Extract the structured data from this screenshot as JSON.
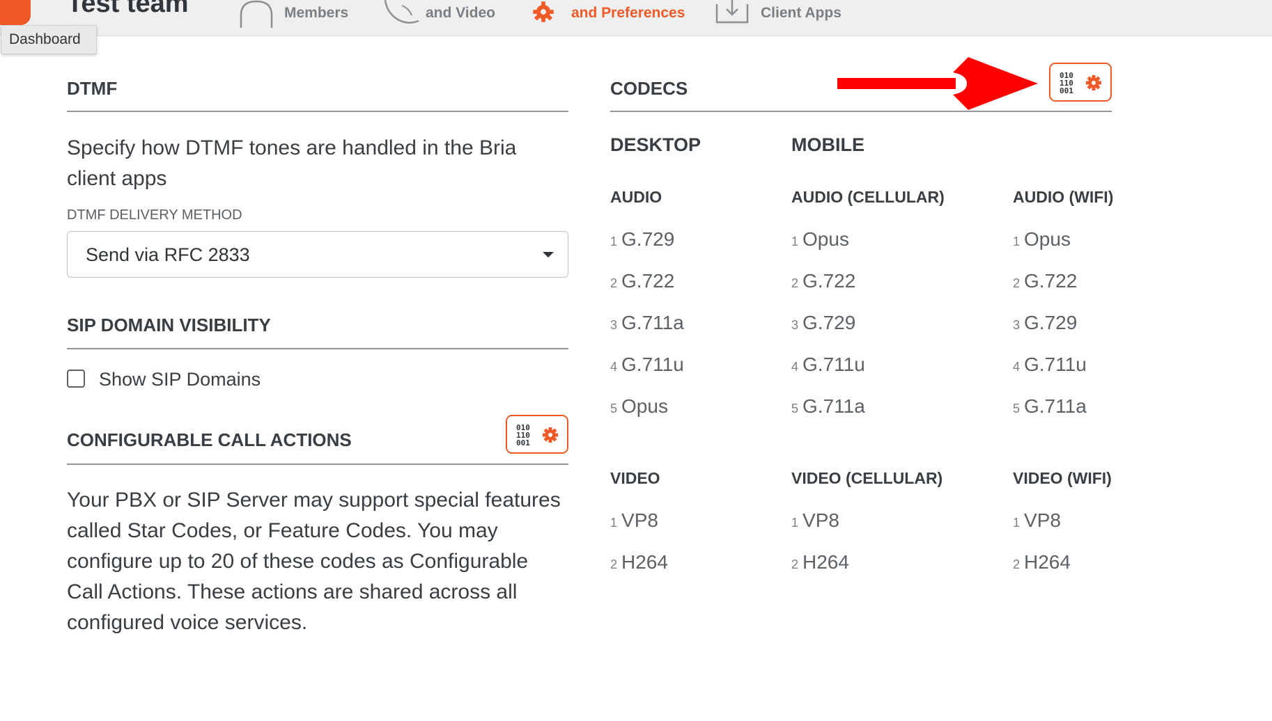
{
  "header": {
    "team_name": "Test team",
    "tooltip": "Dashboard",
    "nav": [
      {
        "label": "Members",
        "icon": "members-icon",
        "active": false
      },
      {
        "label": "and Video",
        "icon": "phone-icon",
        "active": false
      },
      {
        "label": "and Preferences",
        "icon": "gear-icon",
        "active": true
      },
      {
        "label": "Client Apps",
        "icon": "download-icon",
        "active": false
      }
    ]
  },
  "dtmf": {
    "heading": "DTMF",
    "description": "Specify how DTMF tones are handled in the Bria client apps",
    "field_label": "DTMF DELIVERY METHOD",
    "selected": "Send via RFC 2833"
  },
  "sip": {
    "heading": "SIP DOMAIN VISIBILITY",
    "checkbox_label": "Show SIP Domains",
    "checked": false
  },
  "call_actions": {
    "heading": "CONFIGURABLE CALL ACTIONS",
    "description": "Your PBX or SIP Server may support special features called Star Codes, or Feature Codes. You may configure up to 20 of these codes as Configurable Call Actions. These actions are shared across all configured voice services."
  },
  "config_button": {
    "binary_lines": [
      "010",
      "110",
      "001"
    ],
    "icon": "binary-settings-icon"
  },
  "codecs": {
    "heading": "CODECS",
    "desktop_heading": "DESKTOP",
    "mobile_heading": "MOBILE",
    "columns": [
      {
        "audio_heading": "AUDIO",
        "audio": [
          {
            "n": "1",
            "name": "G.729"
          },
          {
            "n": "2",
            "name": "G.722"
          },
          {
            "n": "3",
            "name": "G.711a"
          },
          {
            "n": "4",
            "name": "G.711u"
          },
          {
            "n": "5",
            "name": "Opus"
          }
        ],
        "video_heading": "VIDEO",
        "video": [
          {
            "n": "1",
            "name": "VP8"
          },
          {
            "n": "2",
            "name": "H264"
          }
        ]
      },
      {
        "audio_heading": "AUDIO (CELLULAR)",
        "audio": [
          {
            "n": "1",
            "name": "Opus"
          },
          {
            "n": "2",
            "name": "G.722"
          },
          {
            "n": "3",
            "name": "G.729"
          },
          {
            "n": "4",
            "name": "G.711u"
          },
          {
            "n": "5",
            "name": "G.711a"
          }
        ],
        "video_heading": "VIDEO (CELLULAR)",
        "video": [
          {
            "n": "1",
            "name": "VP8"
          },
          {
            "n": "2",
            "name": "H264"
          }
        ]
      },
      {
        "audio_heading": "AUDIO (WIFI)",
        "audio": [
          {
            "n": "1",
            "name": "Opus"
          },
          {
            "n": "2",
            "name": "G.722"
          },
          {
            "n": "3",
            "name": "G.729"
          },
          {
            "n": "4",
            "name": "G.711u"
          },
          {
            "n": "5",
            "name": "G.711a"
          }
        ],
        "video_heading": "VIDEO (WIFI)",
        "video": [
          {
            "n": "1",
            "name": "VP8"
          },
          {
            "n": "2",
            "name": "H264"
          }
        ]
      }
    ]
  },
  "annotation": {
    "icon": "red-arrow-icon",
    "color": "#ff0000"
  },
  "colors": {
    "accent": "#f05a28",
    "text": "#383e42",
    "muted": "#5b6165"
  }
}
